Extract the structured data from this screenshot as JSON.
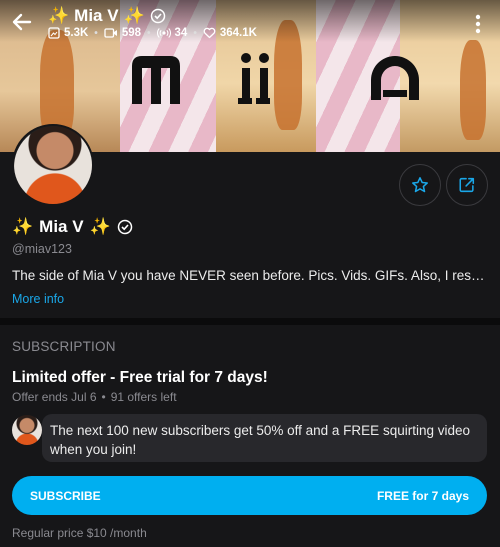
{
  "header": {
    "name": "Mia V",
    "stats": {
      "photos": "5.3K",
      "videos": "598",
      "streams": "34",
      "likes": "364.1K"
    }
  },
  "profile": {
    "name": "Mia V",
    "username": "@miav123",
    "bio": "The side of Mia V you have NEVER seen before. Pics. Vids. GIFs. Also, I respond to DMs!",
    "more_info": "More info"
  },
  "subscription": {
    "section_label": "SUBSCRIPTION",
    "offer_title": "Limited offer - Free trial for 7 days!",
    "offer_ends": "Offer ends Jul 6",
    "offers_left": "91 offers left",
    "message": "The next 100 new subscribers get 50% off and a FREE squirting video when you join!",
    "button_label": "SUBSCRIBE",
    "button_price": "FREE for 7 days",
    "regular_price": "Regular price $10 /month"
  },
  "icons": {
    "back": "arrow-left-icon",
    "verified": "verified-check-icon",
    "sparkle": "sparkle-emoji-icon",
    "photo": "image-icon",
    "video": "video-icon",
    "stream": "broadcast-icon",
    "like": "heart-icon",
    "more": "kebab-menu-icon",
    "favorite": "star-icon",
    "share": "share-icon"
  },
  "colors": {
    "accent": "#00aff0",
    "link": "#1aa7e8",
    "background": "#161618",
    "muted": "#8a8a90"
  }
}
